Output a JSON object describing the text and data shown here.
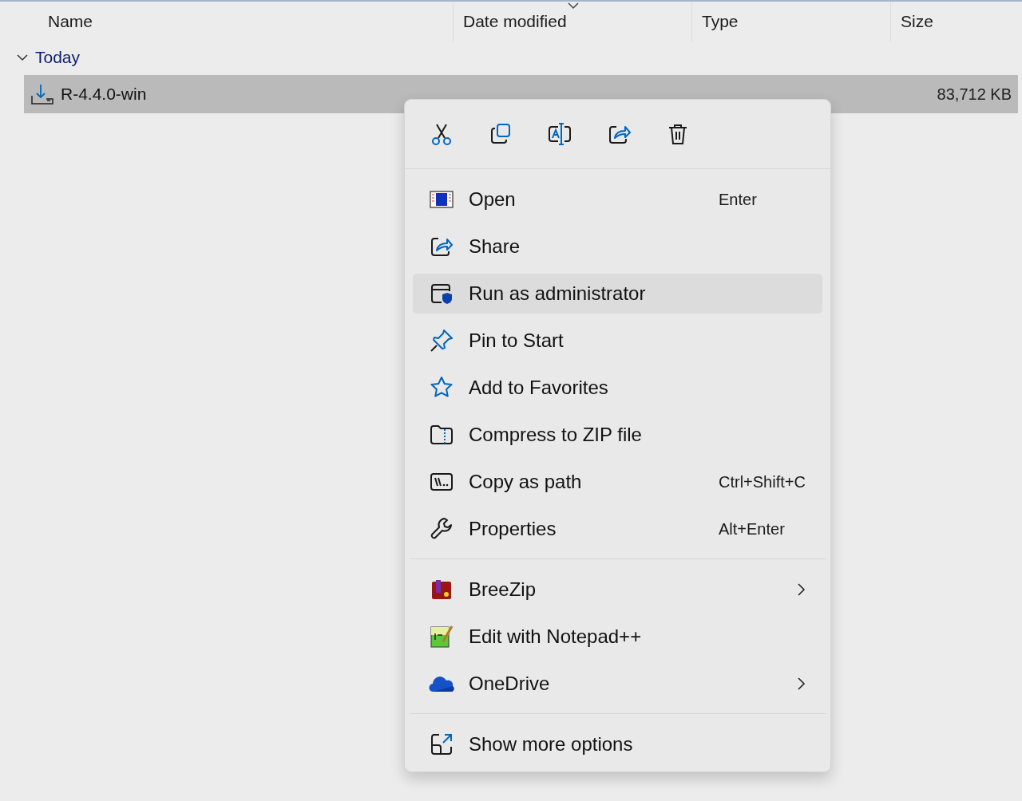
{
  "columns": [
    {
      "label": "Name",
      "sorted": false
    },
    {
      "label": "Date modified",
      "sorted": true
    },
    {
      "label": "Type",
      "sorted": false
    },
    {
      "label": "Size",
      "sorted": false
    }
  ],
  "groups": [
    {
      "label": "Today",
      "expanded": true,
      "files": [
        {
          "name": "R-4.4.0-win",
          "size": "83,712 KB",
          "selected": true
        }
      ]
    }
  ],
  "context_menu": {
    "toolbar": [
      {
        "kind": "cut"
      },
      {
        "kind": "copy"
      },
      {
        "kind": "rename"
      },
      {
        "kind": "share"
      },
      {
        "kind": "delete"
      }
    ],
    "sections": [
      [
        {
          "kind": "open",
          "label": "Open",
          "shortcut": "Enter",
          "selected": false,
          "submenu": false
        },
        {
          "kind": "share",
          "label": "Share",
          "selected": false,
          "submenu": false
        },
        {
          "kind": "admin",
          "label": "Run as administrator",
          "selected": true,
          "submenu": false
        },
        {
          "kind": "pin",
          "label": "Pin to Start",
          "selected": false,
          "submenu": false
        },
        {
          "kind": "star",
          "label": "Add to Favorites",
          "selected": false,
          "submenu": false
        },
        {
          "kind": "zip",
          "label": "Compress to ZIP file",
          "selected": false,
          "submenu": false
        },
        {
          "kind": "path",
          "label": "Copy as path",
          "shortcut": "Ctrl+Shift+C",
          "selected": false,
          "submenu": false
        },
        {
          "kind": "wrench",
          "label": "Properties",
          "shortcut": "Alt+Enter",
          "selected": false,
          "submenu": false
        }
      ],
      [
        {
          "kind": "archive",
          "label": "BreeZip",
          "selected": false,
          "submenu": true
        },
        {
          "kind": "notepad",
          "label": "Edit with Notepad++",
          "selected": false,
          "submenu": false
        },
        {
          "kind": "cloud",
          "label": "OneDrive",
          "selected": false,
          "submenu": true
        }
      ],
      [
        {
          "kind": "expand",
          "label": "Show more options",
          "selected": false,
          "submenu": false
        }
      ]
    ]
  }
}
